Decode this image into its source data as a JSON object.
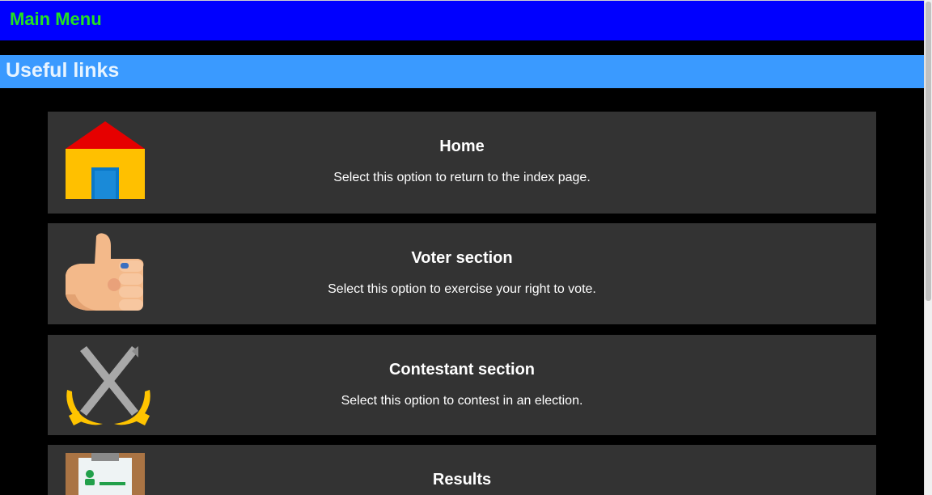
{
  "header": {
    "title": "Main Menu"
  },
  "section": {
    "heading": "Useful links"
  },
  "cards": [
    {
      "title": "Home",
      "description": "Select this option to return to the index page.",
      "icon": "house-icon"
    },
    {
      "title": "Voter section",
      "description": "Select this option to exercise your right to vote.",
      "icon": "thumbs-up-icon"
    },
    {
      "title": "Contestant section",
      "description": "Select this option to contest in an election.",
      "icon": "crossed-swords-icon"
    },
    {
      "title": "Results",
      "description": "",
      "icon": "results-clipboard-icon"
    }
  ],
  "colors": {
    "header_bg": "#0000ff",
    "header_text": "#22e022",
    "section_bg": "#3a9aff",
    "card_bg": "#333333",
    "page_bg": "#000000"
  }
}
